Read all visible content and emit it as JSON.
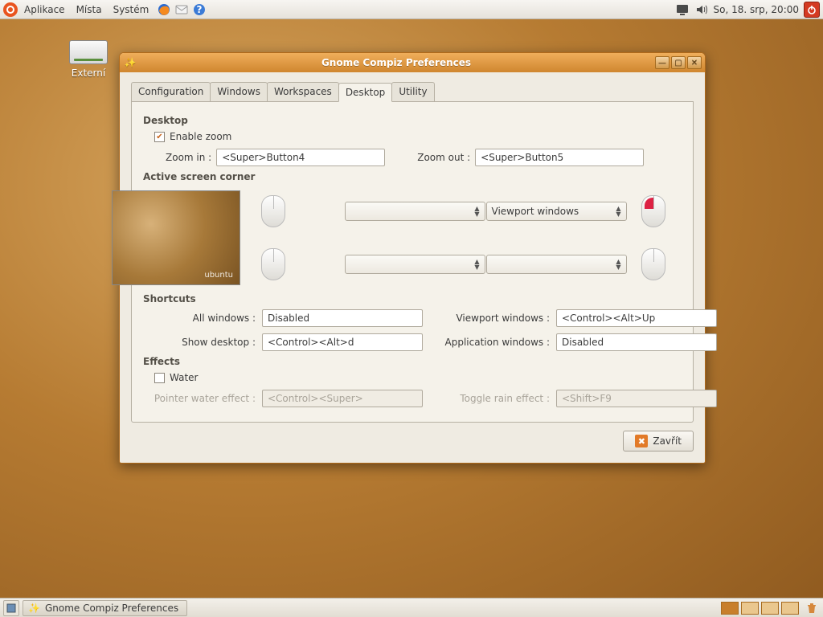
{
  "panel": {
    "menus": [
      "Aplikace",
      "Místa",
      "Systém"
    ],
    "clock": "So, 18. srp, 20:00"
  },
  "desktop": {
    "drive_label": "Externí"
  },
  "window": {
    "title": "Gnome Compiz Preferences",
    "tabs": [
      "Configuration",
      "Windows",
      "Workspaces",
      "Desktop",
      "Utility"
    ],
    "active_tab": 3,
    "desktop_section": {
      "heading": "Desktop",
      "enable_zoom_label": "Enable zoom",
      "enable_zoom_checked": true,
      "zoom_in_label": "Zoom in :",
      "zoom_in_value": "<Super>Button4",
      "zoom_out_label": "Zoom out :",
      "zoom_out_value": "<Super>Button5"
    },
    "corners": {
      "heading": "Active screen corner",
      "tl": "",
      "tr": "Viewport windows",
      "bl": "",
      "br": "",
      "preview_brand": "ubuntu"
    },
    "shortcuts": {
      "heading": "Shortcuts",
      "all_windows_label": "All windows :",
      "all_windows_value": "Disabled",
      "viewport_label": "Viewport windows :",
      "viewport_value": "<Control><Alt>Up",
      "show_desktop_label": "Show desktop :",
      "show_desktop_value": "<Control><Alt>d",
      "app_windows_label": "Application windows :",
      "app_windows_value": "Disabled"
    },
    "effects": {
      "heading": "Effects",
      "water_label": "Water",
      "water_checked": false,
      "pointer_label": "Pointer water effect :",
      "pointer_value": "<Control><Super>",
      "rain_label": "Toggle rain effect :",
      "rain_value": "<Shift>F9"
    },
    "close_label": "Zavřít"
  },
  "taskbar": {
    "task_label": "Gnome Compiz Preferences"
  }
}
